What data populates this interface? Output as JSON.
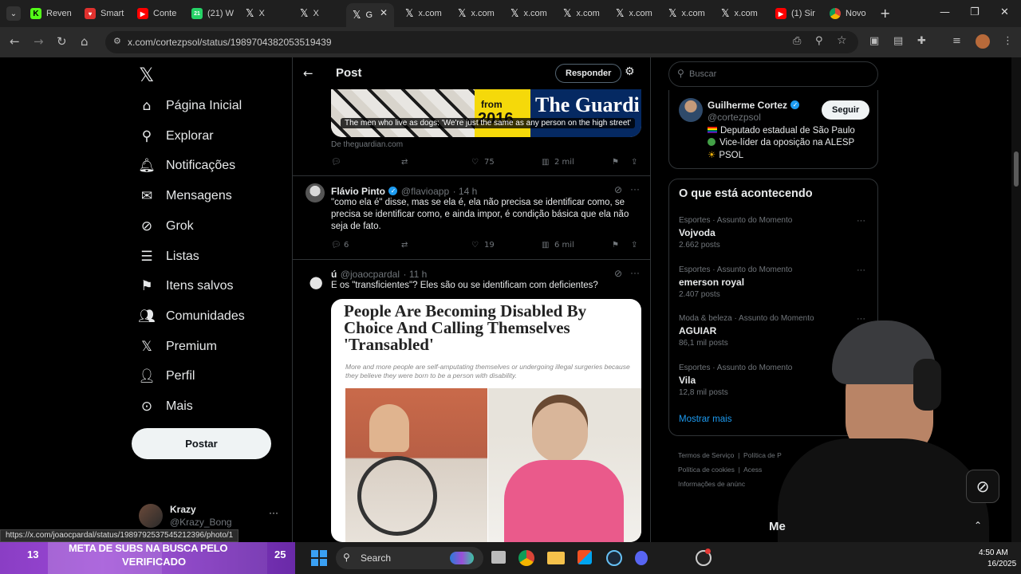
{
  "browser": {
    "tabs": [
      {
        "label": "Reven",
        "icon": "kick-icon",
        "color": "#53fc18"
      },
      {
        "label": "Smart",
        "icon": "smart-icon",
        "color": "#e0312e"
      },
      {
        "label": "Conte",
        "icon": "youtube-icon",
        "color": "#ff0000"
      },
      {
        "label": "(21) W",
        "icon": "whatsapp-icon",
        "color": "#25d366"
      },
      {
        "label": "X",
        "icon": "x-icon",
        "color": "#000000"
      },
      {
        "label": "X",
        "icon": "x-icon",
        "color": "#000000"
      },
      {
        "label": "G",
        "icon": "x-icon",
        "color": "#000000",
        "active": true
      },
      {
        "label": "x.com",
        "icon": "x-icon",
        "color": "#000000"
      },
      {
        "label": "x.com",
        "icon": "x-icon",
        "color": "#000000"
      },
      {
        "label": "x.com",
        "icon": "x-icon",
        "color": "#000000"
      },
      {
        "label": "x.com",
        "icon": "x-icon",
        "color": "#000000"
      },
      {
        "label": "x.com",
        "icon": "x-icon",
        "color": "#000000"
      },
      {
        "label": "x.com",
        "icon": "x-icon",
        "color": "#000000"
      },
      {
        "label": "x.com",
        "icon": "x-icon",
        "color": "#000000"
      },
      {
        "label": "(1) Sir",
        "icon": "youtube-icon",
        "color": "#ff0000"
      },
      {
        "label": "Novo",
        "icon": "chrome-icon",
        "color": "#4285f4"
      }
    ],
    "url": "x.com/cortezpsol/status/1989704382053519439",
    "status_url": "https://x.com/joaocpardal/status/1989792537545212396/photo/1"
  },
  "leftnav": {
    "items": [
      {
        "label": "Página Inicial",
        "icon": "home-icon"
      },
      {
        "label": "Explorar",
        "icon": "search-icon"
      },
      {
        "label": "Notificações",
        "icon": "bell-icon"
      },
      {
        "label": "Mensagens",
        "icon": "mail-icon"
      },
      {
        "label": "Grok",
        "icon": "grok-icon"
      },
      {
        "label": "Listas",
        "icon": "list-icon"
      },
      {
        "label": "Itens salvos",
        "icon": "bookmark-icon"
      },
      {
        "label": "Comunidades",
        "icon": "communities-icon"
      },
      {
        "label": "Premium",
        "icon": "x-icon"
      },
      {
        "label": "Perfil",
        "icon": "person-icon"
      },
      {
        "label": "Mais",
        "icon": "more-circle-icon"
      }
    ],
    "post_button": "Postar",
    "profile": {
      "name": "Krazy",
      "handle": "@Krazy_Bong"
    }
  },
  "center": {
    "header_title": "Post",
    "reply_button": "Responder",
    "card": {
      "caption": "The men who live as dogs: 'We're just the same as any person on the high street'",
      "source": "De theguardian.com",
      "banner_small": "from",
      "banner_year": "2016",
      "banner_brand": "The Guardian",
      "stats": {
        "likes": "75",
        "views": "2 mil"
      }
    },
    "posts": [
      {
        "name": "Flávio Pinto",
        "handle": "@flavioapp",
        "time": "· 14 h",
        "text": "\"como ela  é\" disse, mas se ela é, ela não precisa se identificar como, se precisa se identificar como, e ainda impor, é condição básica que ela não seja de fato.",
        "replies": "6",
        "likes": "19",
        "views": "6 mil"
      },
      {
        "name": "ú",
        "handle": "@joaocpardal",
        "time": "· 11 h",
        "text": "E os \"transficientes\"? Eles são ou se identificam com deficientes?",
        "image_headline": "People Are Becoming Disabled By Choice And Calling Themselves 'Transabled'",
        "image_subhead": "More and more people are self-amputating themselves or undergoing illegal surgeries because they believe they were born to be a person with disability."
      }
    ]
  },
  "right": {
    "search_placeholder": "Buscar",
    "profile": {
      "name": "Guilherme Cortez",
      "handle": "@cortezpsol",
      "follow": "Seguir",
      "bio": [
        "Deputado estadual de São Paulo",
        "Vice-líder da oposição na ALESP",
        "PSOL"
      ]
    },
    "trends_title": "O que está acontecendo",
    "trends": [
      {
        "meta": "Esportes · Assunto do Momento",
        "name": "Vojvoda",
        "count": "2.662 posts"
      },
      {
        "meta": "Esportes · Assunto do Momento",
        "name": "emerson royal",
        "count": "2.407 posts"
      },
      {
        "meta": "Moda & beleza · Assunto do Momento",
        "name": "AGUIAR",
        "count": "86,1 mil posts"
      },
      {
        "meta": "Esportes · Assunto do Momento",
        "name": "Vila",
        "count": "12,8 mil posts"
      }
    ],
    "show_more": "Mostrar mais",
    "footer": [
      "Termos de Serviço",
      "Política de P",
      "Política de cookies",
      "Acess",
      "Informações de anúnc"
    ],
    "messages_label": "Me"
  },
  "overlay": {
    "subs_count": "13",
    "subs_goal": "25",
    "banner_line1": "META DE SUBS NA BUSCA PELO",
    "banner_line2": "VERIFICADO"
  },
  "taskbar": {
    "search_placeholder": "Search",
    "time": "4:50 AM",
    "date": "16/2025"
  }
}
